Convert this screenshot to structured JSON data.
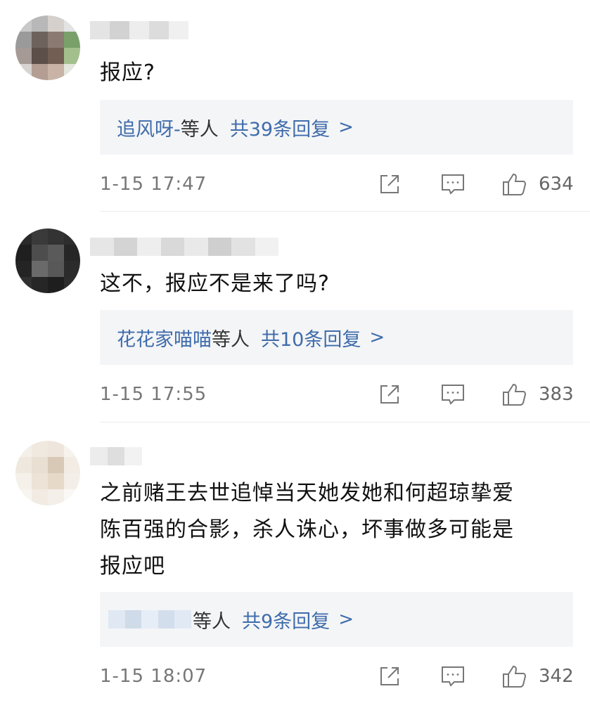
{
  "comments": [
    {
      "text": "报应?",
      "reply_names": "追风呀-",
      "reply_etc": "等人",
      "reply_total": "共39条回复",
      "reply_chevron": ">",
      "time": "1-15 17:47",
      "likes": "634",
      "avatar_colors": [
        "#c9c9c9",
        "#b8b8b8",
        "#d6d0cc",
        "#e3e3e3",
        "#9a9a9a",
        "#6e625c",
        "#8b7a72",
        "#7aa06a",
        "#a59a95",
        "#5c4f49",
        "#735e53",
        "#a3c08c",
        "#d8d4d1",
        "#b49e93",
        "#c8b3a6",
        "#e2e6dc"
      ]
    },
    {
      "text": "这不，报应不是来了吗?",
      "reply_names": "花花家喵喵",
      "reply_etc": "等人",
      "reply_total": "共10条回复",
      "reply_chevron": ">",
      "time": "1-15 17:55",
      "likes": "383",
      "avatar_colors": [
        "#2a2a2a",
        "#3a3a3a",
        "#333333",
        "#2e2e2e",
        "#1f1f1f",
        "#4d4d4d",
        "#5a5a5a",
        "#262626",
        "#242424",
        "#6a6a6a",
        "#585858",
        "#2b2b2b",
        "#303030",
        "#262626",
        "#1e1e1e",
        "#2d2d2d"
      ]
    },
    {
      "text_lines": [
        "之前赌王去世追悼当天她发她和何超琼挚爱",
        "陈百强的合影，杀人诛心，坏事做多可能是",
        "报应吧"
      ],
      "reply_names": "",
      "reply_etc": "等人",
      "reply_total": "共9条回复",
      "reply_chevron": ">",
      "time": "1-15 18:07",
      "likes": "342",
      "avatar_colors": [
        "#f4efe8",
        "#f0e9df",
        "#eee6dc",
        "#f6f2ec",
        "#efe8de",
        "#e9dfd2",
        "#d8c9b6",
        "#f2ece4",
        "#f5f0ea",
        "#ede3d6",
        "#e6d9c8",
        "#f3eee7",
        "#f8f5f1",
        "#f1ebe3",
        "#f4efe9",
        "#faf8f5"
      ]
    }
  ],
  "colors": {
    "link": "#3f6cab",
    "reply_bg": "#f4f5f7",
    "meta": "#777777"
  }
}
